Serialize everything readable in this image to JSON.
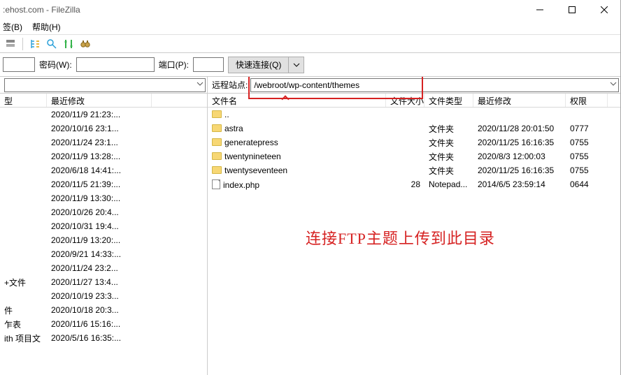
{
  "title_bar": {
    "caption": ":ehost.com - FileZilla"
  },
  "menu": {
    "item1": "签(B)",
    "item2": "帮助(H)"
  },
  "conn": {
    "pwd_label": "密码(W):",
    "port_label": "端口(P):",
    "host_value": "",
    "pwd_value": "",
    "port_value": "",
    "quick_btn": "快速连接(Q)"
  },
  "left": {
    "addr_empty": "",
    "columns": {
      "type": "型",
      "modified": "最近修改"
    },
    "rows": [
      {
        "type": "",
        "modified": "2020/11/9 21:23:..."
      },
      {
        "type": "",
        "modified": "2020/10/16 23:1..."
      },
      {
        "type": "",
        "modified": "2020/11/24 23:1..."
      },
      {
        "type": "",
        "modified": "2020/11/9 13:28:..."
      },
      {
        "type": "",
        "modified": "2020/6/18 14:41:..."
      },
      {
        "type": "",
        "modified": "2020/11/5 21:39:..."
      },
      {
        "type": "",
        "modified": "2020/11/9 13:30:..."
      },
      {
        "type": "",
        "modified": "2020/10/26 20:4..."
      },
      {
        "type": "",
        "modified": "2020/10/31 19:4..."
      },
      {
        "type": "",
        "modified": "2020/11/9 13:20:..."
      },
      {
        "type": "",
        "modified": "2020/9/21 14:33:..."
      },
      {
        "type": "",
        "modified": "2020/11/24 23:2..."
      },
      {
        "type": "+文件",
        "modified": "2020/11/27 13:4..."
      },
      {
        "type": "",
        "modified": "2020/10/19 23:3..."
      },
      {
        "type": "件",
        "modified": "2020/10/18 20:3..."
      },
      {
        "type": "乍表",
        "modified": "2020/11/6 15:16:..."
      },
      {
        "type": "ith 项目文",
        "modified": "2020/5/16 16:35:..."
      }
    ]
  },
  "right": {
    "addr_label": "远程站点:",
    "addr_value": "/webroot/wp-content/themes",
    "columns": {
      "name": "文件名",
      "size": "文件大小",
      "type": "文件类型",
      "modified": "最近修改",
      "perm": "权限"
    },
    "rows": [
      {
        "icon": "folder",
        "name": "..",
        "size": "",
        "type": "",
        "modified": "",
        "perm": ""
      },
      {
        "icon": "folder",
        "name": "astra",
        "size": "",
        "type": "文件夹",
        "modified": "2020/11/28 20:01:50",
        "perm": "0777"
      },
      {
        "icon": "folder",
        "name": "generatepress",
        "size": "",
        "type": "文件夹",
        "modified": "2020/11/25 16:16:35",
        "perm": "0755"
      },
      {
        "icon": "folder",
        "name": "twentynineteen",
        "size": "",
        "type": "文件夹",
        "modified": "2020/8/3 12:00:03",
        "perm": "0755"
      },
      {
        "icon": "folder",
        "name": "twentyseventeen",
        "size": "",
        "type": "文件夹",
        "modified": "2020/11/25 16:16:35",
        "perm": "0755"
      },
      {
        "icon": "file",
        "name": "index.php",
        "size": "28",
        "type": "Notepad...",
        "modified": "2014/6/5 23:59:14",
        "perm": "0644"
      }
    ]
  },
  "annotation": {
    "text": "连接FTP主题上传到此目录"
  }
}
